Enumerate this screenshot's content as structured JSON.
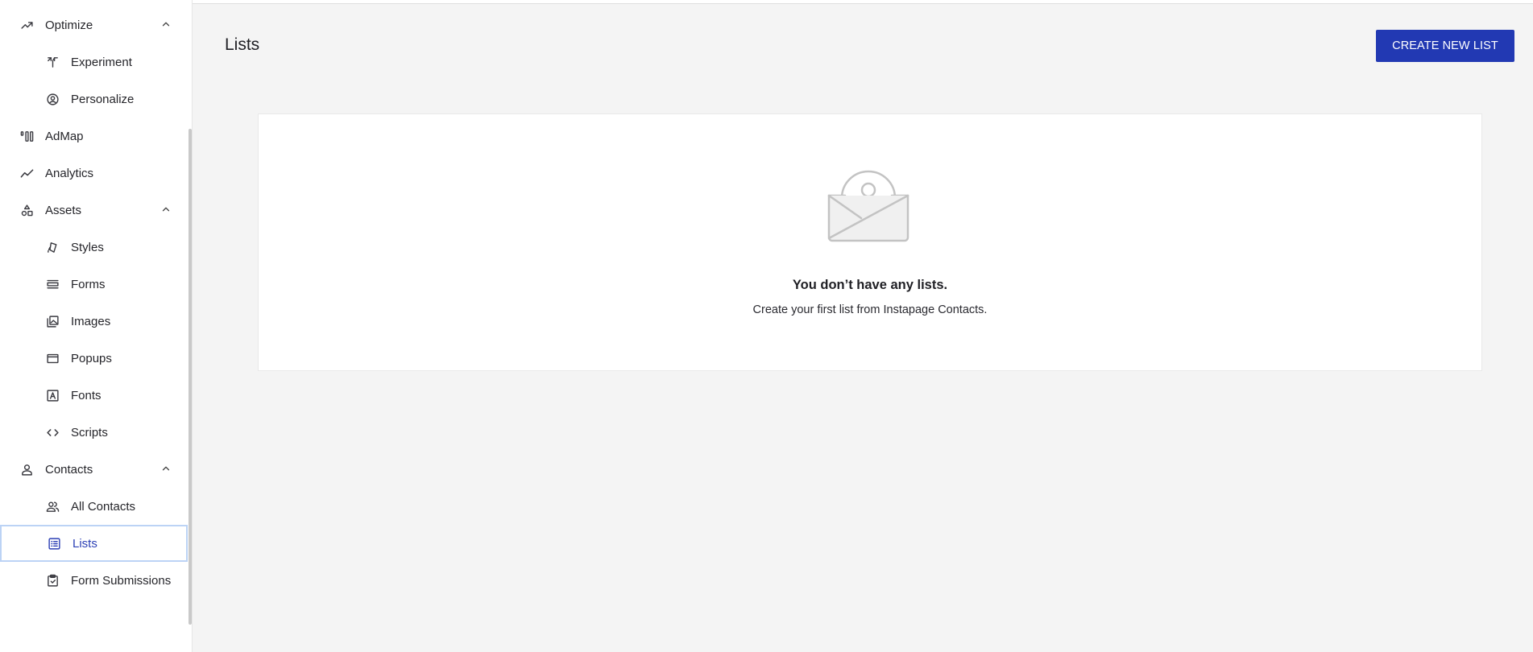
{
  "sidebar": {
    "items": [
      {
        "label": "Optimize",
        "icon": "trending-up-icon",
        "expanded": true
      },
      {
        "label": "Experiment",
        "icon": "split-arrows-icon"
      },
      {
        "label": "Personalize",
        "icon": "user-circle-icon"
      },
      {
        "label": "AdMap",
        "icon": "admap-bars-icon"
      },
      {
        "label": "Analytics",
        "icon": "line-chart-icon"
      },
      {
        "label": "Assets",
        "icon": "shapes-icon",
        "expanded": true
      },
      {
        "label": "Styles",
        "icon": "brush-icon"
      },
      {
        "label": "Forms",
        "icon": "form-lines-icon"
      },
      {
        "label": "Images",
        "icon": "images-icon"
      },
      {
        "label": "Popups",
        "icon": "window-icon"
      },
      {
        "label": "Fonts",
        "icon": "font-box-icon"
      },
      {
        "label": "Scripts",
        "icon": "code-icon"
      },
      {
        "label": "Contacts",
        "icon": "person-icon",
        "expanded": true
      },
      {
        "label": "All Contacts",
        "icon": "people-icon"
      },
      {
        "label": "Lists",
        "icon": "list-box-icon",
        "active": true
      },
      {
        "label": "Form Submissions",
        "icon": "clipboard-check-icon"
      }
    ]
  },
  "main": {
    "title": "Lists",
    "create_button": "CREATE NEW LIST",
    "empty_state": {
      "icon": "envelope-contact-icon",
      "title": "You don’t have any lists.",
      "subtitle": "Create your first list from Instapage Contacts."
    }
  },
  "colors": {
    "accent": "#2239b3",
    "active_border": "#bcd3f5",
    "background": "#f4f4f4"
  }
}
